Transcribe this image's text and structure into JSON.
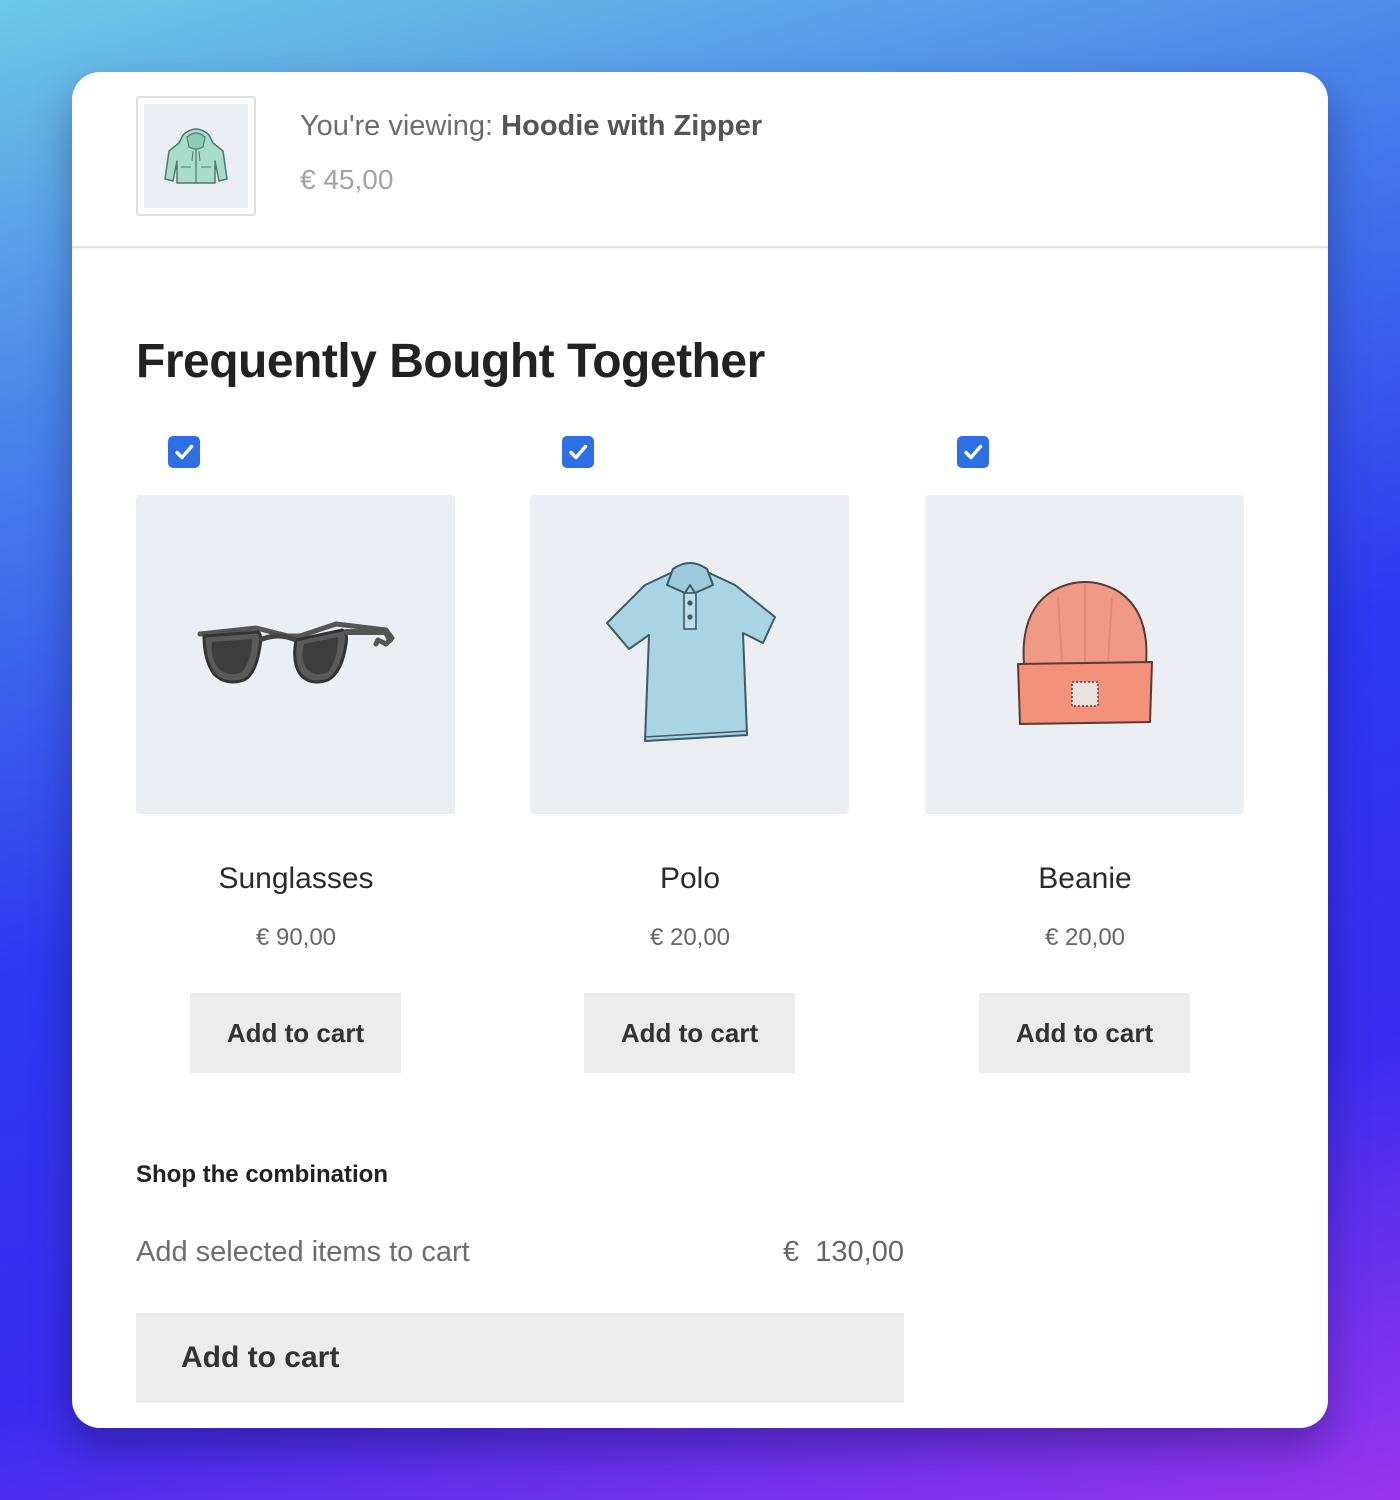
{
  "viewing": {
    "prefix": "You're viewing:",
    "product_name": "Hoodie with Zipper",
    "price": "€ 45,00",
    "thumbnail_icon": "hoodie-icon"
  },
  "section": {
    "title": "Frequently Bought Together"
  },
  "products": [
    {
      "name": "Sunglasses",
      "price": "€ 90,00",
      "button_label": "Add to cart",
      "checked": true,
      "icon": "sunglasses-icon"
    },
    {
      "name": "Polo",
      "price": "€ 20,00",
      "button_label": "Add to cart",
      "checked": true,
      "icon": "polo-shirt-icon"
    },
    {
      "name": "Beanie",
      "price": "€ 20,00",
      "button_label": "Add to cart",
      "checked": true,
      "icon": "beanie-icon"
    }
  ],
  "combination": {
    "label": "Shop the combination",
    "description": "Add selected items to cart",
    "total": "€  130,00",
    "button_label": "Add to cart"
  },
  "colors": {
    "checkbox": "#2f6fe4",
    "button_bg": "#ececec",
    "image_bg": "#ebeef3"
  }
}
